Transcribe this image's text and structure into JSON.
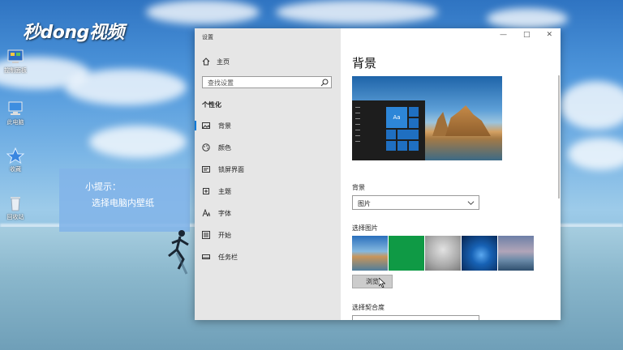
{
  "brand": "秒dong视频",
  "desktop_icons": [
    {
      "label": "网络",
      "icon": "network-icon"
    },
    {
      "label": "控制面板",
      "icon": "control-panel-icon"
    },
    {
      "label": "此电脑",
      "icon": "computer-icon"
    },
    {
      "label": "收藏",
      "icon": "star-icon"
    },
    {
      "label": "回收站",
      "icon": "recycle-bin-icon"
    }
  ],
  "tip": {
    "line1": "小提示：",
    "line2": "选择电脑内壁纸"
  },
  "settings": {
    "title": "设置",
    "controls": [
      "—",
      "□",
      "✕"
    ],
    "home": "主页",
    "search_placeholder": "查找设置",
    "section": "个性化",
    "nav": [
      {
        "label": "背景",
        "icon": "picture-icon",
        "selected": true
      },
      {
        "label": "颜色",
        "icon": "palette-icon"
      },
      {
        "label": "锁屏界面",
        "icon": "lock-screen-icon"
      },
      {
        "label": "主题",
        "icon": "theme-icon"
      },
      {
        "label": "字体",
        "icon": "font-icon"
      },
      {
        "label": "开始",
        "icon": "start-icon"
      },
      {
        "label": "任务栏",
        "icon": "taskbar-icon"
      }
    ],
    "main": {
      "heading": "背景",
      "preview_tile_text": "Aa",
      "background_label": "背景",
      "background_value": "图片",
      "choose_picture_label": "选择图片",
      "browse_label": "浏览",
      "fit_label": "选择契合度"
    }
  },
  "colors": {
    "accent": "#0078d7"
  }
}
